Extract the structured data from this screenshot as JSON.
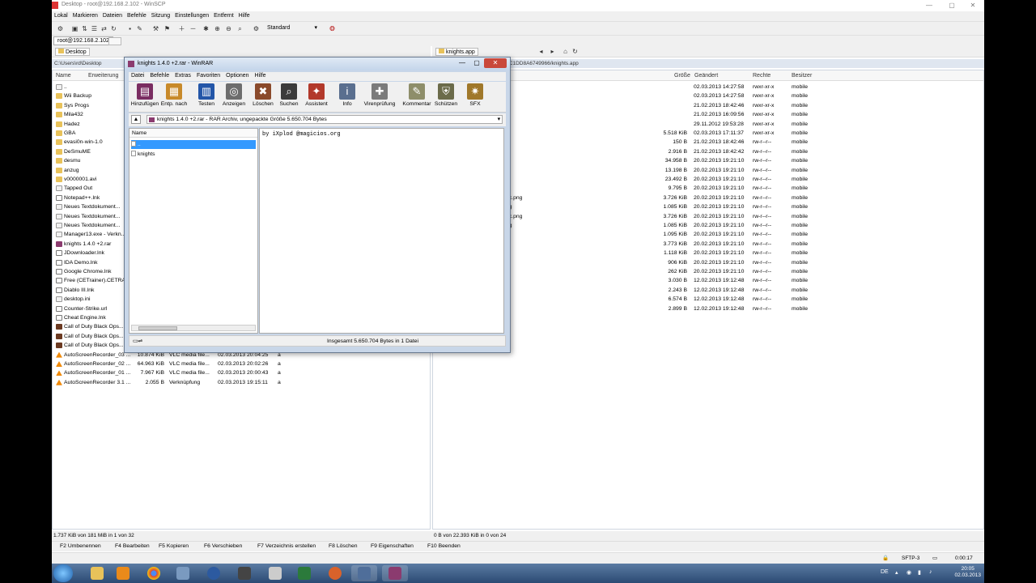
{
  "winscp": {
    "title": "Desktop - root@192.168.2.102 - WinSCP",
    "menu": [
      "Lokal",
      "Markieren",
      "Dateien",
      "Befehle",
      "Sitzung",
      "Einstellungen",
      "Entfernt",
      "Hilfe"
    ],
    "toolbar_profile": "Standard",
    "session_tab": "root@192.168.2.102",
    "left_path_combo": "Desktop",
    "left_path_line": "C:\\Users\\rd\\Desktop",
    "right_path_combo": "knights.app",
    "right_path_line": "...F9EC866E-3A92-4E78-9E3F-C1DD8A6749966/knights.app",
    "left_columns": [
      "Name",
      "Erweiterung"
    ],
    "right_columns": [
      "Größe",
      "Geändert",
      "Rechte",
      "Besitzer"
    ],
    "left_rows": [
      {
        "icon": "up",
        "name": ".."
      },
      {
        "icon": "folder",
        "name": "Wii Backup"
      },
      {
        "icon": "folder",
        "name": "Sys Progs"
      },
      {
        "icon": "folder",
        "name": "Mila432"
      },
      {
        "icon": "folder",
        "name": "Hadez"
      },
      {
        "icon": "folder",
        "name": "GBA"
      },
      {
        "icon": "folder",
        "name": "evasi0n-win-1.0"
      },
      {
        "icon": "folder",
        "name": "DeSmuME"
      },
      {
        "icon": "folder",
        "name": "desmu"
      },
      {
        "icon": "folder",
        "name": "anzug"
      },
      {
        "icon": "folder",
        "name": "v0000001.avi"
      },
      {
        "icon": "file",
        "name": "Tapped Out"
      },
      {
        "icon": "shortcut",
        "name": "Notepad++.lnk"
      },
      {
        "icon": "file",
        "name": "Neues Textdokument..."
      },
      {
        "icon": "file",
        "name": "Neues Textdokument..."
      },
      {
        "icon": "file",
        "name": "Neues Textdokument..."
      },
      {
        "icon": "file",
        "name": "Manager13.exe - Verkn..."
      },
      {
        "icon": "rar",
        "name": "knights 1.4.0 +2.rar"
      },
      {
        "icon": "shortcut",
        "name": "JDownloader.lnk"
      },
      {
        "icon": "shortcut",
        "name": "IDA Demo.lnk"
      },
      {
        "icon": "shortcut",
        "name": "Google Chrome.lnk"
      },
      {
        "icon": "shortcut",
        "name": "Free (CETrainer).CETRA..."
      },
      {
        "icon": "shortcut",
        "name": "Diablo III.lnk"
      },
      {
        "icon": "file",
        "name": "desktop.ini"
      },
      {
        "icon": "shortcut",
        "name": "Counter-Strike.url"
      },
      {
        "icon": "shortcut",
        "name": "Cheat Engine.lnk"
      },
      {
        "icon": "dark",
        "name": "Call of Duty Black Ops..."
      },
      {
        "icon": "dark",
        "name": "Call of Duty Black Ops..."
      },
      {
        "icon": "dark",
        "name": "Call of Duty Black Ops..."
      }
    ],
    "left_rows_detail": [
      {
        "icon": "vlc",
        "name": "AutoScreenRecorder_03 ...",
        "size": "10.874 KiB",
        "type": "VLC media file...",
        "date": "02.03.2013",
        "time": "20:04:25",
        "attr": "a"
      },
      {
        "icon": "vlc",
        "name": "AutoScreenRecorder_02 ...",
        "size": "64.963 KiB",
        "type": "VLC media file...",
        "date": "02.03.2013",
        "time": "20:02:26",
        "attr": "a"
      },
      {
        "icon": "vlc",
        "name": "AutoScreenRecorder_01 ...",
        "size": "7.967 KiB",
        "type": "VLC media file...",
        "date": "02.03.2013",
        "time": "20:00:43",
        "attr": "a"
      },
      {
        "icon": "vlc",
        "name": "AutoScreenRecorder 3.1 ...",
        "size": "2.055 B",
        "type": "Verknüpfung",
        "date": "02.03.2013",
        "time": "19:15:11",
        "attr": "a"
      }
    ],
    "right_fragments": [
      "2x.png",
      "ng",
      "2x.png",
      "ng"
    ],
    "right_rows": [
      {
        "size": "",
        "date": "02.03.2013 14:27:58",
        "rights": "rwxr-xr-x",
        "owner": "mobile"
      },
      {
        "size": "",
        "date": "02.03.2013 14:27:58",
        "rights": "rwxr-xr-x",
        "owner": "mobile"
      },
      {
        "size": "",
        "date": "21.02.2013 18:42:46",
        "rights": "rwxr-xr-x",
        "owner": "mobile"
      },
      {
        "size": "",
        "date": "21.02.2013 16:09:56",
        "rights": "rwxr-xr-x",
        "owner": "mobile"
      },
      {
        "size": "",
        "date": "29.11.2012 19:53:28",
        "rights": "rwxr-xr-x",
        "owner": "mobile"
      },
      {
        "size": "5.518 KiB",
        "date": "02.03.2013 17:11:37",
        "rights": "rwxr-xr-x",
        "owner": "mobile"
      },
      {
        "size": "150 B",
        "date": "21.02.2013 18:42:46",
        "rights": "rw-r--r--",
        "owner": "mobile"
      },
      {
        "size": "2.916 B",
        "date": "21.02.2013 18:42:42",
        "rights": "rw-r--r--",
        "owner": "mobile"
      },
      {
        "size": "34.958 B",
        "date": "20.02.2013 19:21:10",
        "rights": "rw-r--r--",
        "owner": "mobile"
      },
      {
        "size": "13.198 B",
        "date": "20.02.2013 19:21:10",
        "rights": "rw-r--r--",
        "owner": "mobile"
      },
      {
        "size": "23.492 B",
        "date": "20.02.2013 19:21:10",
        "rights": "rw-r--r--",
        "owner": "mobile"
      },
      {
        "size": "9.795 B",
        "date": "20.02.2013 19:21:10",
        "rights": "rw-r--r--",
        "owner": "mobile"
      },
      {
        "size": "3.726 KiB",
        "date": "20.02.2013 19:21:10",
        "rights": "rw-r--r--",
        "owner": "mobile"
      },
      {
        "size": "1.085 KiB",
        "date": "20.02.2013 19:21:10",
        "rights": "rw-r--r--",
        "owner": "mobile"
      },
      {
        "size": "3.726 KiB",
        "date": "20.02.2013 19:21:10",
        "rights": "rw-r--r--",
        "owner": "mobile"
      },
      {
        "size": "1.085 KiB",
        "date": "20.02.2013 19:21:10",
        "rights": "rw-r--r--",
        "owner": "mobile"
      },
      {
        "size": "1.095 KiB",
        "date": "20.02.2013 19:21:10",
        "rights": "rw-r--r--",
        "owner": "mobile"
      },
      {
        "size": "3.773 KiB",
        "date": "20.02.2013 19:21:10",
        "rights": "rw-r--r--",
        "owner": "mobile"
      },
      {
        "size": "1.118 KiB",
        "date": "20.02.2013 19:21:10",
        "rights": "rw-r--r--",
        "owner": "mobile"
      },
      {
        "size": "906 KiB",
        "date": "20.02.2013 19:21:10",
        "rights": "rw-r--r--",
        "owner": "mobile"
      },
      {
        "size": "262 KiB",
        "date": "20.02.2013 19:21:10",
        "rights": "rw-r--r--",
        "owner": "mobile"
      },
      {
        "size": "3.030 B",
        "date": "12.02.2013 19:12:48",
        "rights": "rw-r--r--",
        "owner": "mobile"
      },
      {
        "size": "2.243 B",
        "date": "12.02.2013 19:12:48",
        "rights": "rw-r--r--",
        "owner": "mobile"
      },
      {
        "size": "6.574 B",
        "date": "12.02.2013 19:12:48",
        "rights": "rw-r--r--",
        "owner": "mobile"
      },
      {
        "size": "2.899 B",
        "date": "12.02.2013 19:12:48",
        "rights": "rw-r--r--",
        "owner": "mobile"
      }
    ],
    "status_left": "1.737 KiB von 181 MiB in 1 von 32",
    "status_right": "0 B von 22.393 KiB in 0 von 24",
    "fkeys": [
      "F2 Umbenennen",
      "F4 Bearbeiten",
      "F5 Kopieren",
      "F6 Verschieben",
      "F7 Verzeichnis erstellen",
      "F8 Löschen",
      "F9 Eigenschaften",
      "F10 Beenden"
    ],
    "protocol": "SFTP-3",
    "session_time": "0:00:17"
  },
  "winrar": {
    "title": "knights 1.4.0 +2.rar - WinRAR",
    "menu": [
      "Datei",
      "Befehle",
      "Extras",
      "Favoriten",
      "Optionen",
      "Hilfe"
    ],
    "tools": [
      {
        "label": "Hinzufügen",
        "icon": "books-add-icon",
        "color": "#7a2d62"
      },
      {
        "label": "Entp. nach",
        "icon": "folder-extract-icon",
        "color": "#c88a2a"
      },
      {
        "label": "Testen",
        "icon": "book-test-icon",
        "color": "#2356a8"
      },
      {
        "label": "Anzeigen",
        "icon": "glasses-view-icon",
        "color": "#6d6d6d"
      },
      {
        "label": "Löschen",
        "icon": "delete-icon",
        "color": "#8a4a2b"
      },
      {
        "label": "Suchen",
        "icon": "binoculars-find-icon",
        "color": "#3b3b3b"
      },
      {
        "label": "Assistent",
        "icon": "wizard-icon",
        "color": "#b2392b"
      },
      {
        "label": "Info",
        "icon": "info-icon",
        "color": "#5a6f8f"
      },
      {
        "label": "Virenprüfung",
        "icon": "virus-scan-icon",
        "color": "#7b7b7b"
      },
      {
        "label": "Kommentar",
        "icon": "comment-icon",
        "color": "#8e8e6a"
      },
      {
        "label": "Schützen",
        "icon": "shield-protect-icon",
        "color": "#6b6b4a"
      },
      {
        "label": "SFX",
        "icon": "sfx-icon",
        "color": "#a0782a"
      }
    ],
    "address": "knights 1.4.0 +2.rar - RAR Archiv, ungepackte Größe 5.650.704 Bytes",
    "tree_header": "Name",
    "tree_items": [
      "..",
      "knights"
    ],
    "comment": "by iXplod @magicios.org",
    "status_left": "",
    "status_right": "Insgesamt 5.650.704 Bytes in 1 Datei"
  },
  "taskbar": {
    "lang": "DE",
    "time": "20:05",
    "date": "02.03.2013"
  }
}
